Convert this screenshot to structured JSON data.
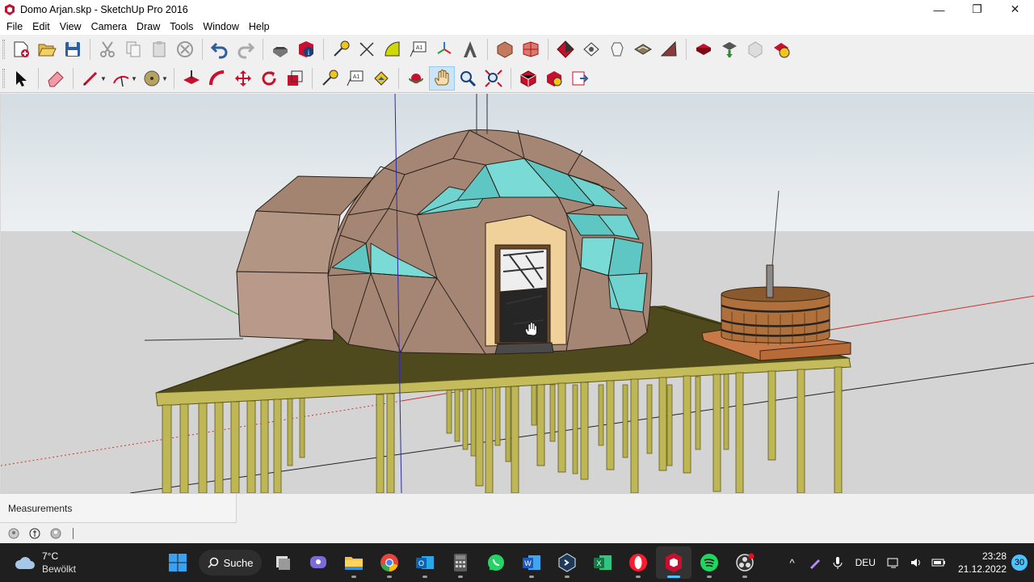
{
  "window": {
    "title": "Domo Arjan.skp - SketchUp Pro 2016",
    "minimize_glyph": "—",
    "maximize_glyph": "❐",
    "close_glyph": "✕"
  },
  "menu": {
    "items": [
      "File",
      "Edit",
      "View",
      "Camera",
      "Draw",
      "Tools",
      "Window",
      "Help"
    ]
  },
  "toolbar": {
    "row1_icons": [
      "new-icon",
      "open-icon",
      "save-icon",
      "cut-icon",
      "copy-icon",
      "paste-icon",
      "erase-icon",
      "undo-icon",
      "redo-icon",
      "print-icon",
      "model-info-icon",
      "tape-measure-icon",
      "dimension-icon",
      "protractor-icon",
      "text-icon",
      "axes-icon",
      "3d-text-icon",
      "get-models-icon",
      "share-model-icon",
      "share-component-icon",
      "extension-warehouse-icon",
      "layout-icon",
      "sandbox-icon",
      "styles-icon",
      "shadows-icon",
      "section-icon",
      "solid-tools-icon",
      "add-location-icon",
      "toggle-terrain-icon",
      "photo-textures-icon",
      "advanced-camera-icon"
    ],
    "row2_icons": [
      "select-icon",
      "eraser-icon",
      "line-icon",
      "arc-icon",
      "circle-icon",
      "push-pull-icon",
      "follow-me-icon",
      "move-icon",
      "rotate-icon",
      "scale-icon",
      "tape-measure-icon",
      "text-icon",
      "paint-bucket-icon",
      "orbit-icon",
      "pan-icon",
      "zoom-icon",
      "zoom-extents-icon",
      "warehouse-icon",
      "extension-icon",
      "send-to-layout-icon"
    ],
    "active_tool": "pan-icon"
  },
  "measurements": {
    "label": "Measurements"
  },
  "taskbar": {
    "weather": {
      "temp": "7°C",
      "condition": "Bewölkt"
    },
    "search_label": "Suche",
    "apps": [
      "start-icon",
      "search-icon",
      "task-view-icon",
      "chat-icon",
      "file-explorer-icon",
      "chrome-icon",
      "outlook-icon",
      "calculator-icon",
      "whatsapp-icon",
      "word-icon",
      "vscode-icon",
      "excel-icon",
      "opera-icon",
      "sketchup-icon",
      "spotify-icon",
      "obs-icon"
    ],
    "focused_app": "sketchup-icon",
    "language": "DEU",
    "time": "23:28",
    "date": "21.12.2022",
    "notification_count": "30"
  },
  "colors": {
    "sky": "#e6ebee",
    "ground": "#d4d4d4",
    "dome": "#a78775",
    "glass": "#6fd3d0",
    "platform": "#4e4a1d",
    "posts": "#bfb656",
    "taskbar": "#1f1f1f",
    "accent": "#4cc2ff"
  }
}
